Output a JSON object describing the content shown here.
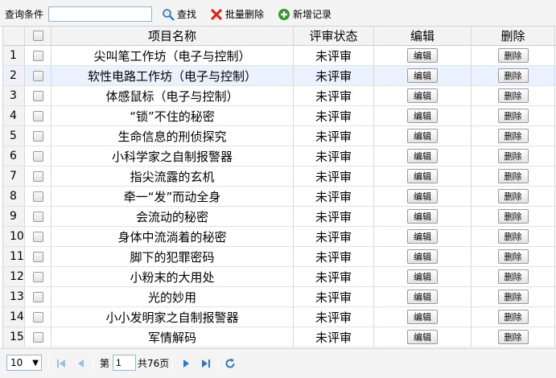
{
  "toolbar": {
    "query_label": "查询条件",
    "search_input_value": "",
    "search_label": "查找",
    "batch_delete_label": "批量删除",
    "add_record_label": "新增记录"
  },
  "table": {
    "headers": {
      "name": "项目名称",
      "status": "评审状态",
      "edit": "编辑",
      "delete": "删除"
    },
    "edit_button_label": "编辑",
    "delete_button_label": "删除",
    "rows": [
      {
        "num": "1",
        "name": "尖叫笔工作坊（电子与控制）",
        "status": "未评审",
        "edit": "编辑",
        "del": "删除"
      },
      {
        "num": "2",
        "name": "软性电路工作坊（电子与控制）",
        "status": "未评审",
        "edit": "编辑",
        "del": "删除"
      },
      {
        "num": "3",
        "name": "体感鼠标（电子与控制）",
        "status": "未评审",
        "edit": "编辑",
        "del": "删除"
      },
      {
        "num": "4",
        "name": "“锁”不住的秘密",
        "status": "未评审",
        "edit": "编辑",
        "del": "删除"
      },
      {
        "num": "5",
        "name": "生命信息的刑侦探究",
        "status": "未评审",
        "edit": "编辑",
        "del": "删除"
      },
      {
        "num": "6",
        "name": "小科学家之自制报警器",
        "status": "未评审",
        "edit": "编辑",
        "del": "删除"
      },
      {
        "num": "7",
        "name": "指尖流露的玄机",
        "status": "未评审",
        "edit": "编辑",
        "del": "删除"
      },
      {
        "num": "8",
        "name": "牵一“发”而动全身",
        "status": "未评审",
        "edit": "编辑",
        "del": "删除"
      },
      {
        "num": "9",
        "name": "会流动的秘密",
        "status": "未评审",
        "edit": "编辑",
        "del": "删除"
      },
      {
        "num": "10",
        "name": "身体中流淌着的秘密",
        "status": "未评审",
        "edit": "编辑",
        "del": "删除"
      },
      {
        "num": "11",
        "name": "脚下的犯罪密码",
        "status": "未评审",
        "edit": "编辑",
        "del": "删除"
      },
      {
        "num": "12",
        "name": "小粉末的大用处",
        "status": "未评审",
        "edit": "编辑",
        "del": "删除"
      },
      {
        "num": "13",
        "name": "光的妙用",
        "status": "未评审",
        "edit": "编辑",
        "del": "删除"
      },
      {
        "num": "14",
        "name": "小小发明家之自制报警器",
        "status": "未评审",
        "edit": "编辑",
        "del": "删除"
      },
      {
        "num": "15",
        "name": "军情解码",
        "status": "未评审",
        "edit": "编辑",
        "del": "删除"
      }
    ],
    "selected_row": 2
  },
  "pager": {
    "page_size": "10",
    "page_prefix": "第",
    "current_page": "1",
    "total_pages_text": "共76页"
  },
  "colors": {
    "selected_row": "#eaf2ff",
    "search_icon": "#2f6fb3",
    "delete_icon": "#d9251c",
    "add_icon": "#2e9a2e",
    "pager_icon": "#2f78c8"
  }
}
